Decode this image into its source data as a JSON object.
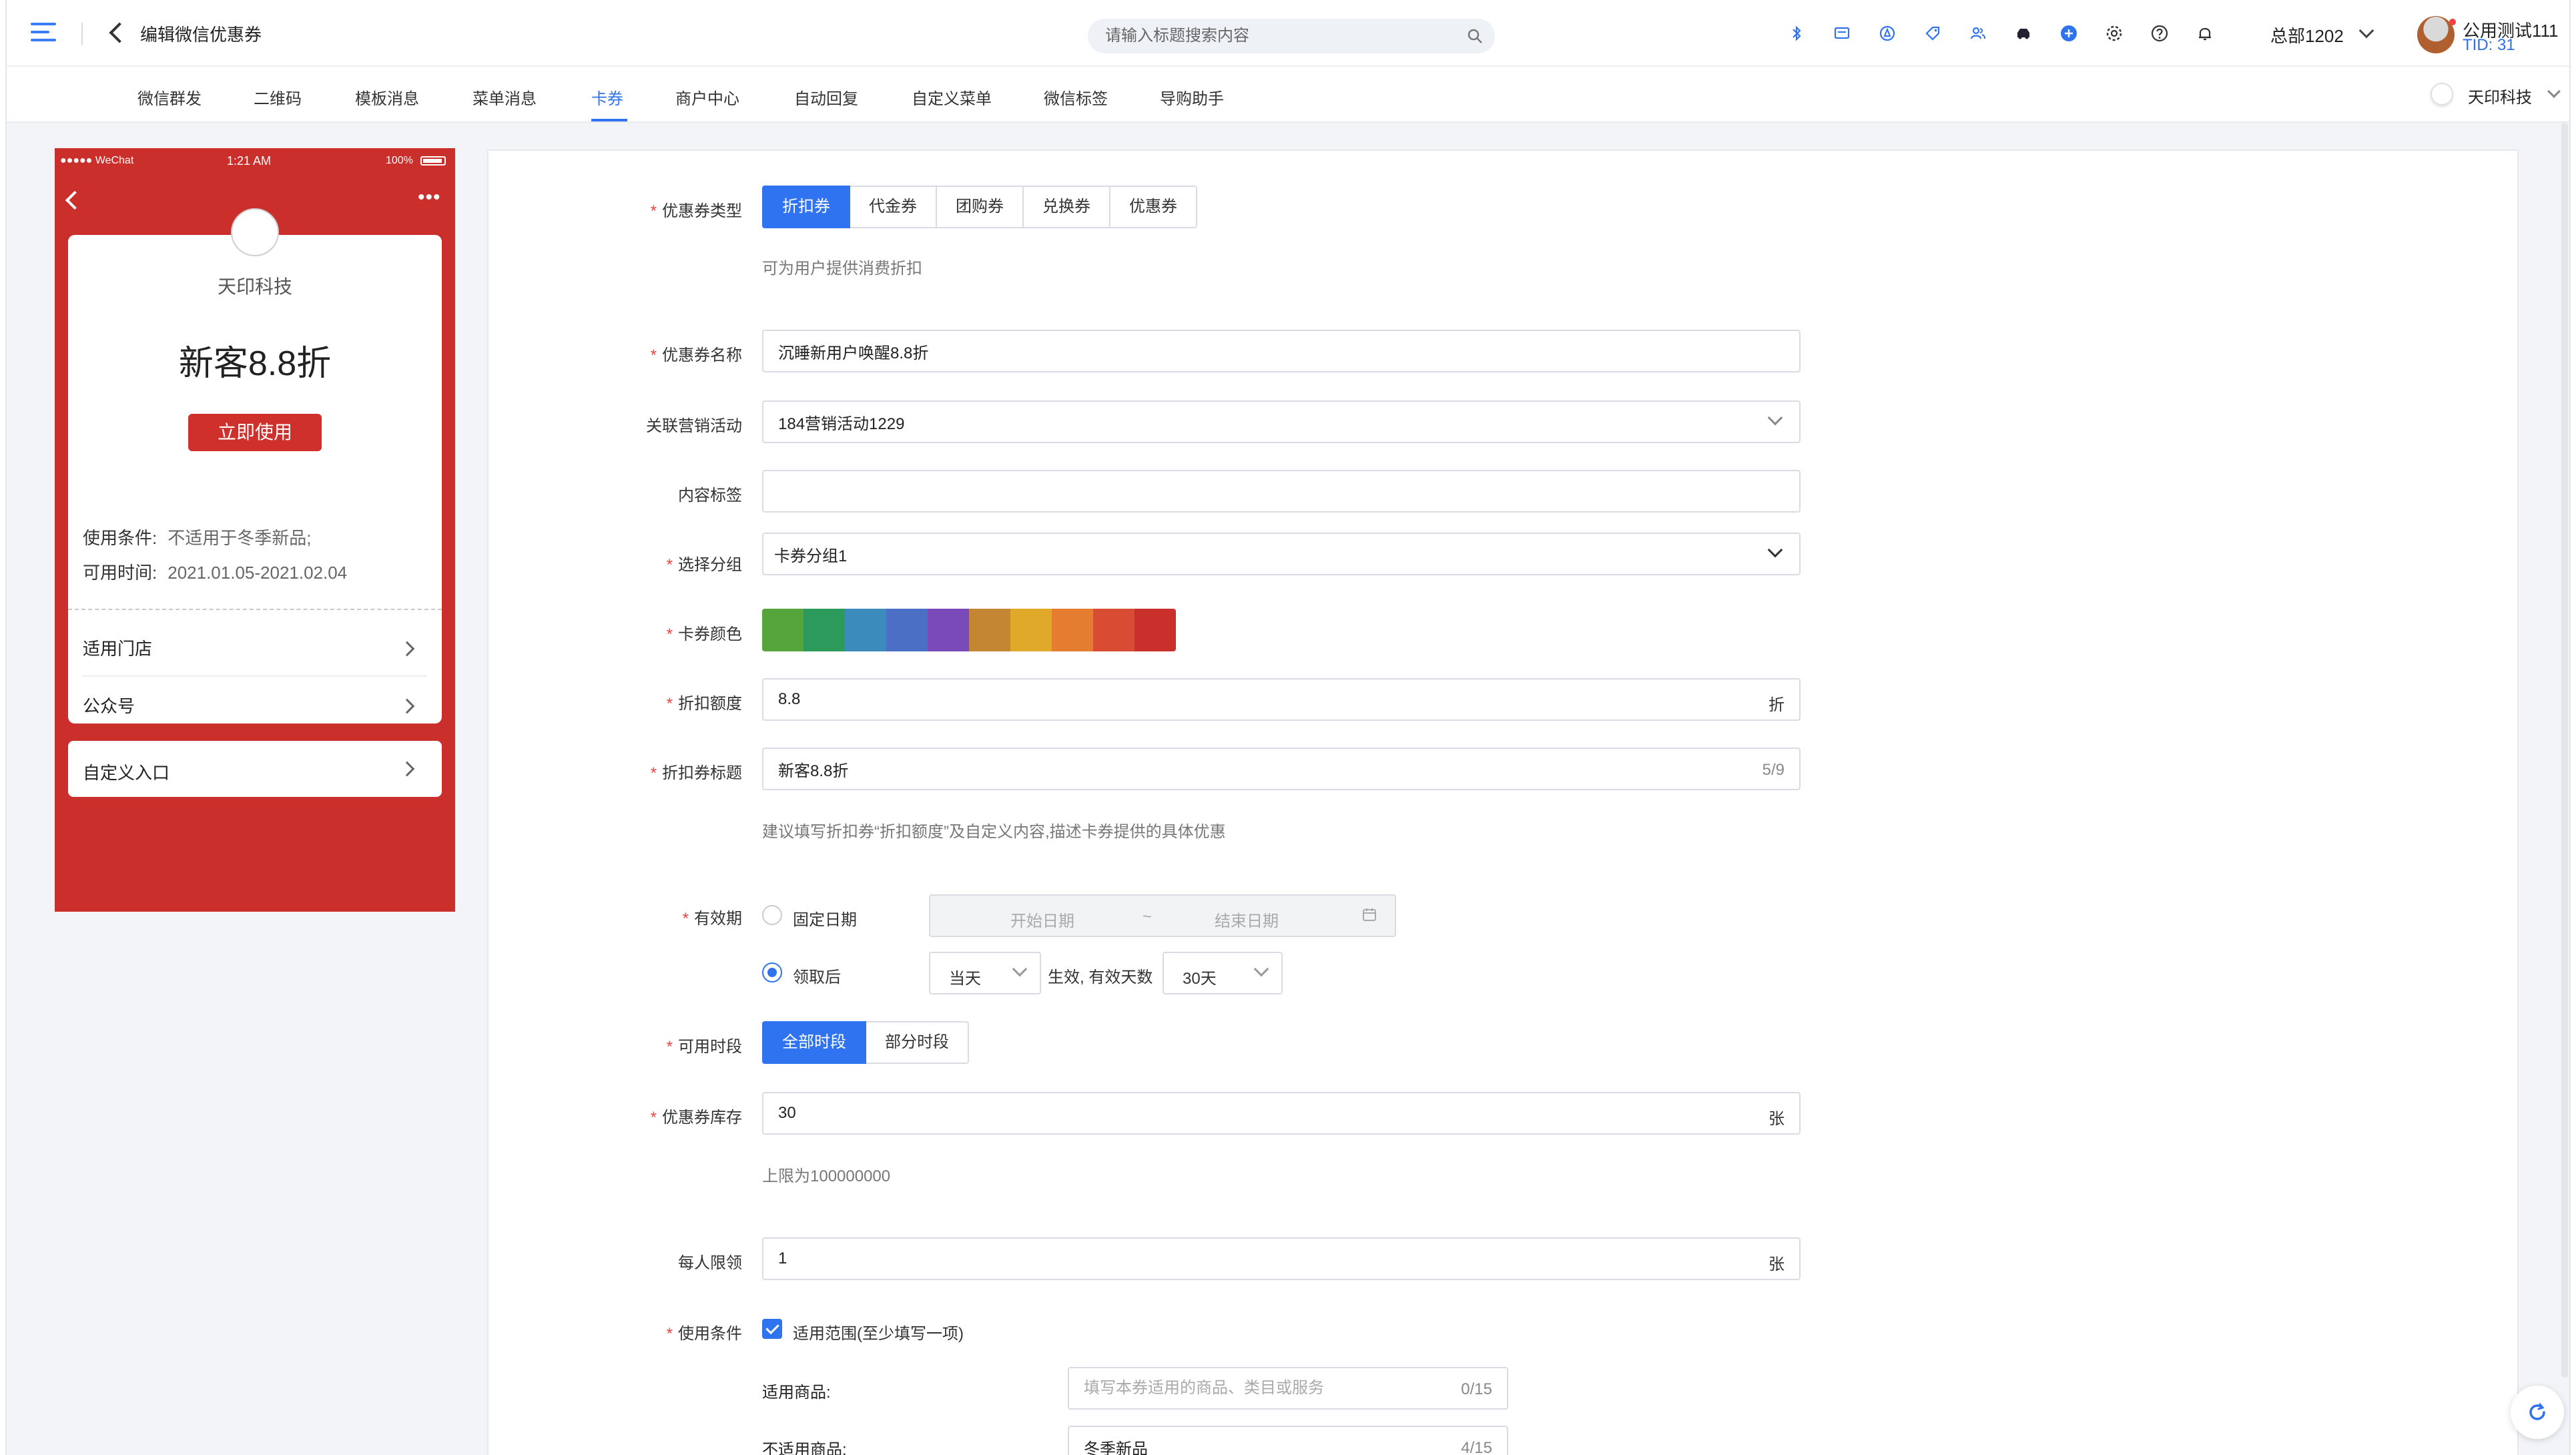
{
  "header": {
    "title": "编辑微信优惠券",
    "search_placeholder": "请输入标题搜索内容",
    "branch": "总部1202",
    "user_name": "公用测试111",
    "user_tid": "TID: 31"
  },
  "tool_icons": [
    "bluetooth-icon",
    "message-icon",
    "compass-icon",
    "tag-icon",
    "users-icon",
    "car-icon",
    "plus-circle-icon",
    "settings-icon",
    "help-icon",
    "bell-icon"
  ],
  "subnav": {
    "items": [
      "微信群发",
      "二维码",
      "模板消息",
      "菜单消息",
      "卡券",
      "商户中心",
      "自动回复",
      "自定义菜单",
      "微信标签",
      "导购助手"
    ],
    "active": "卡券",
    "org": "天印科技"
  },
  "phone": {
    "status_left": "●●●●● WeChat",
    "status_time": "1:21 AM",
    "status_battery": "100%",
    "brand": "天印科技",
    "coupon_title": "新客8.8折",
    "use_button": "立即使用",
    "cond_label": "使用条件:",
    "cond_value": "不适用于冬季新品;",
    "time_label": "可用时间:",
    "time_value": "2021.01.05-2021.02.04",
    "row_stores": "适用门店",
    "row_account": "公众号",
    "row_custom": "自定义入口"
  },
  "form": {
    "coupon_type": {
      "label": "优惠券类型",
      "options": [
        "折扣券",
        "代金券",
        "团购券",
        "兑换券",
        "优惠券"
      ],
      "selected": "折扣券",
      "hint": "可为用户提供消费折扣"
    },
    "coupon_name": {
      "label": "优惠券名称",
      "value": "沉睡新用户唤醒8.8折"
    },
    "campaign": {
      "label": "关联营销活动",
      "value": "184营销活动1229"
    },
    "content_tag": {
      "label": "内容标签",
      "value": ""
    },
    "group": {
      "label": "选择分组",
      "value": "卡券分组1"
    },
    "color": {
      "label": "卡券颜色",
      "swatches": [
        "#55a53c",
        "#2c9a5a",
        "#3b8bbd",
        "#4a6fc4",
        "#7a4bb8",
        "#c58633",
        "#e0a92a",
        "#e47d30",
        "#d84c34",
        "#c9302c"
      ]
    },
    "discount": {
      "label": "折扣额度",
      "value": "8.8",
      "suffix": "折"
    },
    "discount_title": {
      "label": "折扣券标题",
      "value": "新客8.8折",
      "counter": "5/9",
      "hint": "建议填写折扣券“折扣额度”及自定义内容,描述卡券提供的具体优惠"
    },
    "validity": {
      "label": "有效期",
      "fixed_label": "固定日期",
      "start_placeholder": "开始日期",
      "range_sep": "~",
      "end_placeholder": "结束日期",
      "after_label": "领取后",
      "start_value": "当天",
      "mid_text": "生效, 有效天数",
      "days_value": "30天"
    },
    "periods": {
      "label": "可用时段",
      "options": [
        "全部时段",
        "部分时段"
      ],
      "selected": "全部时段"
    },
    "stock": {
      "label": "优惠券库存",
      "value": "30",
      "suffix": "张",
      "hint": "上限为100000000"
    },
    "per_person": {
      "label": "每人限领",
      "value": "1",
      "suffix": "张"
    },
    "conditions": {
      "label": "使用条件",
      "checkbox_label": "适用范围(至少填写一项)",
      "applicable_label": "适用商品:",
      "applicable_placeholder": "填写本券适用的商品、类目或服务",
      "applicable_counter": "0/15",
      "excluded_label": "不适用商品:",
      "excluded_value": "冬季新品",
      "excluded_counter": "4/15"
    }
  }
}
